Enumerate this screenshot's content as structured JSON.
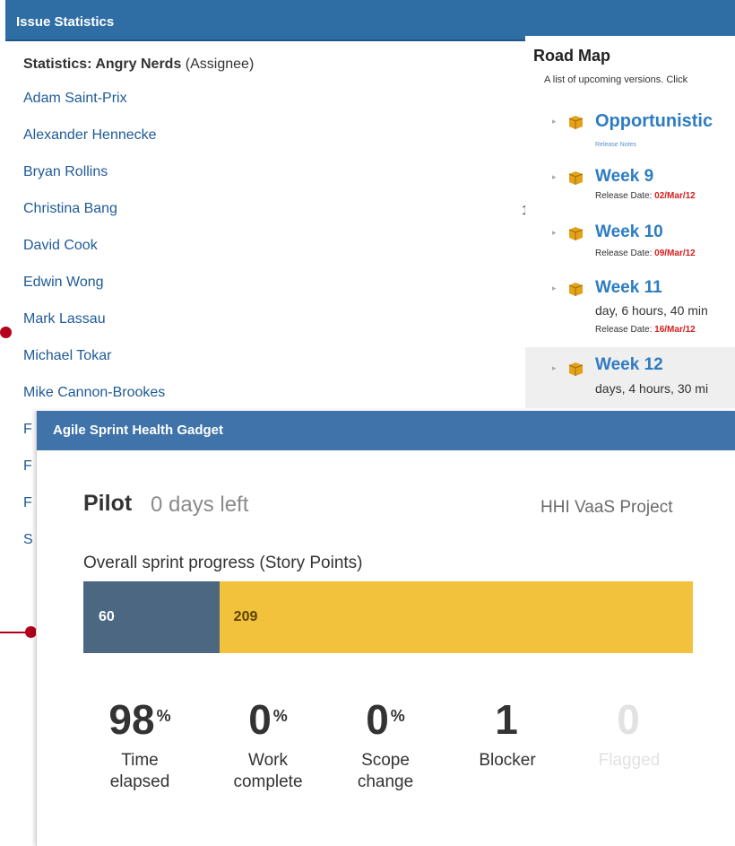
{
  "issue_statistics": {
    "header": "Issue Statistics",
    "subtitle_bold": "Statistics: Angry Nerds",
    "subtitle_normal": "(Assignee)",
    "assignees": [
      "Adam Saint-Prix",
      "Alexander Hennecke",
      "Bryan Rollins",
      "Christina Bang",
      "David Cook",
      "Edwin Wong",
      "Mark Lassau",
      "Michael Tokar",
      "Mike Cannon-Brookes",
      "F",
      "F",
      "F",
      "S"
    ],
    "partial_value": "1"
  },
  "road_map": {
    "title": "Road Map",
    "description": "A list of upcoming versions. Click",
    "release_date_label": "Release Date:",
    "versions": [
      {
        "name": "Opportunistic",
        "notes": "Release Notes"
      },
      {
        "name": "Week 9",
        "release_date": "02/Mar/12"
      },
      {
        "name": "Week 10",
        "release_date": "09/Mar/12"
      },
      {
        "name": "Week 11",
        "remaining": "day, 6 hours, 40 min",
        "release_date": "16/Mar/12"
      },
      {
        "name": "Week 12",
        "remaining": "days, 4 hours, 30 mi"
      }
    ],
    "colors": {
      "version_name": "#2e7cc2",
      "release_date": "#d61c1c"
    }
  },
  "sprint_health": {
    "header": "Agile Sprint Health Gadget",
    "sprint_name": "Pilot",
    "days_left": "0 days left",
    "project": "HHI VaaS Project",
    "progress_label": "Overall sprint progress (Story Points)",
    "progress": {
      "done": 60,
      "remaining": 209
    },
    "colors": {
      "done": "#4b6782",
      "remaining": "#f3c23c",
      "header": "#3f73aa"
    },
    "metrics": [
      {
        "value": "98",
        "suffix": "%",
        "label_line1": "Time",
        "label_line2": "elapsed",
        "disabled": false
      },
      {
        "value": "0",
        "suffix": "%",
        "label_line1": "Work",
        "label_line2": "complete",
        "disabled": false
      },
      {
        "value": "0",
        "suffix": "%",
        "label_line1": "Scope",
        "label_line2": "change",
        "disabled": false
      },
      {
        "value": "1",
        "suffix": "",
        "label_line1": "Blocker",
        "label_line2": "",
        "disabled": false
      },
      {
        "value": "0",
        "suffix": "",
        "label_line1": "Flagged",
        "label_line2": "",
        "disabled": true
      }
    ]
  },
  "annotation_color": "#b3001b"
}
